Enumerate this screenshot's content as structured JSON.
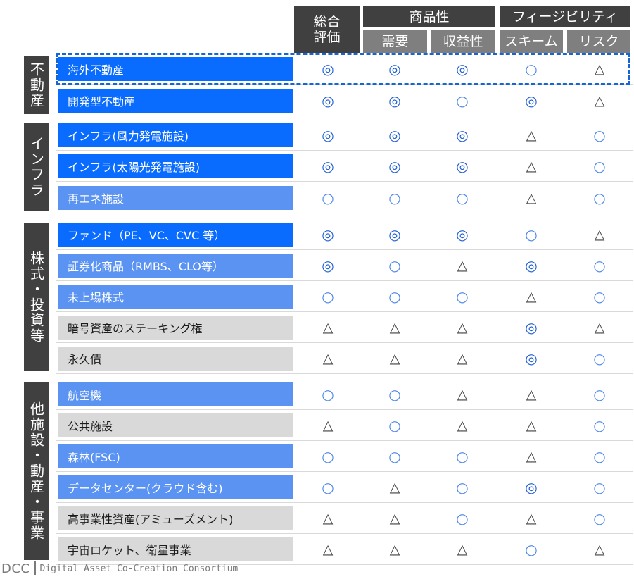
{
  "header": {
    "overall": "総合\n評価",
    "marketability": "商品性",
    "feasibility": "フィージビリティ",
    "columns": [
      "需要",
      "収益性",
      "スキーム",
      "リスク"
    ]
  },
  "groups": [
    {
      "label": "不動産"
    },
    {
      "label": "インフラ"
    },
    {
      "label": "株式・投資等"
    },
    {
      "label": "他施設・動産・事業"
    }
  ],
  "rows": [
    {
      "label": "海外不動産",
      "style": "dark",
      "marks": [
        "◎",
        "◎",
        "◎",
        "○",
        "△"
      ]
    },
    {
      "label": "開発型不動産",
      "style": "dark",
      "marks": [
        "◎",
        "◎",
        "○",
        "◎",
        "△"
      ]
    },
    {
      "label": "インフラ(風力発電施設)",
      "style": "dark",
      "marks": [
        "◎",
        "◎",
        "◎",
        "△",
        "○"
      ]
    },
    {
      "label": "インフラ(太陽光発電施設)",
      "style": "dark",
      "marks": [
        "◎",
        "◎",
        "◎",
        "△",
        "○"
      ]
    },
    {
      "label": "再エネ施設",
      "style": "mid",
      "marks": [
        "○",
        "○",
        "○",
        "△",
        "○"
      ]
    },
    {
      "label": "ファンド（PE、VC、CVC 等）",
      "style": "dark",
      "marks": [
        "◎",
        "◎",
        "◎",
        "○",
        "△"
      ]
    },
    {
      "label": "証券化商品（RMBS、CLO等）",
      "style": "mid",
      "marks": [
        "◎",
        "○",
        "△",
        "◎",
        "○"
      ]
    },
    {
      "label": "未上場株式",
      "style": "mid",
      "marks": [
        "○",
        "○",
        "○",
        "△",
        "○"
      ]
    },
    {
      "label": "暗号資産のステーキング権",
      "style": "grey",
      "marks": [
        "△",
        "△",
        "△",
        "◎",
        "△"
      ]
    },
    {
      "label": "永久債",
      "style": "grey",
      "marks": [
        "△",
        "△",
        "△",
        "◎",
        "○"
      ]
    },
    {
      "label": "航空機",
      "style": "mid",
      "marks": [
        "○",
        "○",
        "△",
        "△",
        "○"
      ]
    },
    {
      "label": "公共施設",
      "style": "grey",
      "marks": [
        "△",
        "○",
        "△",
        "△",
        "○"
      ]
    },
    {
      "label": "森林(FSC)",
      "style": "mid",
      "marks": [
        "○",
        "○",
        "○",
        "△",
        "○"
      ]
    },
    {
      "label": "データセンター(クラウド含む)",
      "style": "mid",
      "marks": [
        "○",
        "△",
        "○",
        "◎",
        "○"
      ]
    },
    {
      "label": "高事業性資産(アミューズメント)",
      "style": "grey",
      "marks": [
        "△",
        "△",
        "○",
        "△",
        "○"
      ]
    },
    {
      "label": "宇宙ロケット、衛星事業",
      "style": "grey",
      "marks": [
        "△",
        "△",
        "△",
        "○",
        "△"
      ]
    }
  ],
  "footer": {
    "logo": "DCC",
    "full_name": "Digital Asset Co-Creation Consortium"
  },
  "colors": {
    "header_dark": "#404040",
    "header_grey": "#7f7f7f",
    "label_dark": "#0a6bff",
    "label_mid": "#5b93f2",
    "label_grey": "#d9d9d9",
    "highlight": "#1565d8"
  }
}
